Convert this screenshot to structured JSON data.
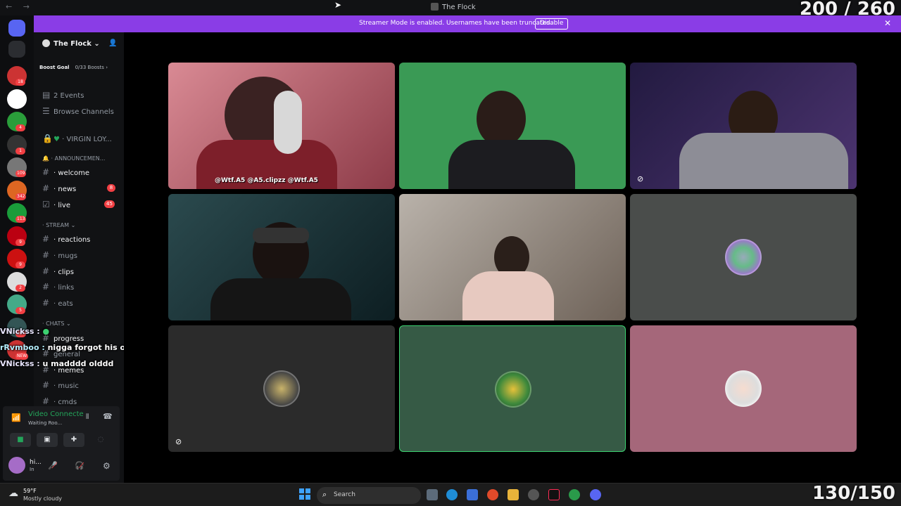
{
  "window": {
    "title": "The Flock",
    "nav_back": "←",
    "nav_forward": "→"
  },
  "overlay_counters": {
    "top": "200 / 260",
    "bottom": "130/150"
  },
  "banner": {
    "message": "Streamer Mode is enabled. Usernames have been truncated.",
    "button": "Disable",
    "close": "✕"
  },
  "guilds": [
    {
      "badge": "18",
      "color": "#c33"
    },
    {
      "badge": "",
      "color": "#fff"
    },
    {
      "badge": "4",
      "color": "#2a9d3a"
    },
    {
      "badge": "1",
      "color": "#333"
    },
    {
      "badge": "109",
      "color": "#777"
    },
    {
      "badge": "342",
      "color": "#d62"
    },
    {
      "badge": "113",
      "color": "#1a9c3a"
    },
    {
      "badge": "9",
      "color": "#b01"
    },
    {
      "badge": "9",
      "color": "#c11"
    },
    {
      "badge": "2",
      "color": "#ddd"
    },
    {
      "badge": "5",
      "color": "#4a8"
    },
    {
      "badge": "204",
      "color": "#355"
    },
    {
      "badge": "NEW",
      "color": "#c33"
    }
  ],
  "sidebar": {
    "server_name": "The Flock",
    "boost_goal": "Boost Goal",
    "boost_count": "0/33 Boosts",
    "events": "2 Events",
    "browse": "Browse Channels",
    "locked_channel": "VIRGIN LOY...",
    "categories": {
      "announcements": "ANNOUNCEMEN...",
      "stream": "Stream",
      "chats": "Chats"
    },
    "channels": {
      "welcome": "welcome",
      "news": "news",
      "news_badge": "8",
      "live": "live",
      "live_badge": "45",
      "reactions": "reactions",
      "mugs": "mugs",
      "clips": "clips",
      "links": "links",
      "eats": "eats",
      "progress": "progress",
      "general": "general",
      "memes": "memes",
      "music": "music",
      "cmds": "cmds"
    }
  },
  "voice": {
    "status": "Video Connecte",
    "sub": "Waiting Roo...",
    "user": "hi...",
    "user_sub": "In"
  },
  "chat_overlay": [
    {
      "user": "VNickss :",
      "text": ""
    },
    {
      "user": "rRvmboo :",
      "text": "nigga forgot his own age?"
    },
    {
      "user": "VNickss :",
      "text": "u madddd olddd"
    }
  ],
  "stage": {
    "caption": "@Wtf.A5  @A5.clipzz  @Wtf.A5"
  },
  "taskbar": {
    "temp": "59°F",
    "weather": "Mostly cloudy",
    "search": "Search"
  }
}
